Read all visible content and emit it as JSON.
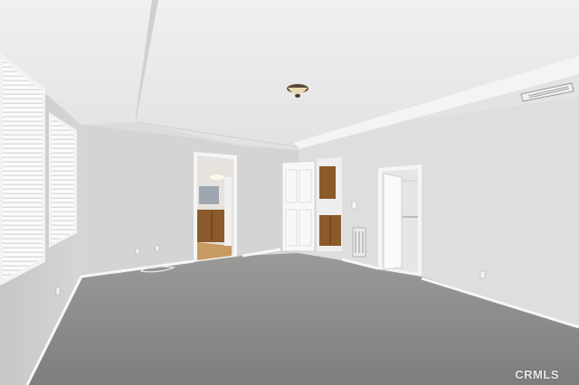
{
  "scene": {
    "description_kind": "empty carpeted bedroom interior photo",
    "colors": {
      "ceiling": "#e9e9e9",
      "wall_left": "#cfcfcf",
      "wall_back": "#d9d9d9",
      "wall_right": "#e0e0e0",
      "carpet": "#8a8a88",
      "trim": "#f7f7f7",
      "wood": "#8b5a2b",
      "floor_wood": "#c79a62"
    }
  },
  "watermark": {
    "text": "CRMLS"
  }
}
